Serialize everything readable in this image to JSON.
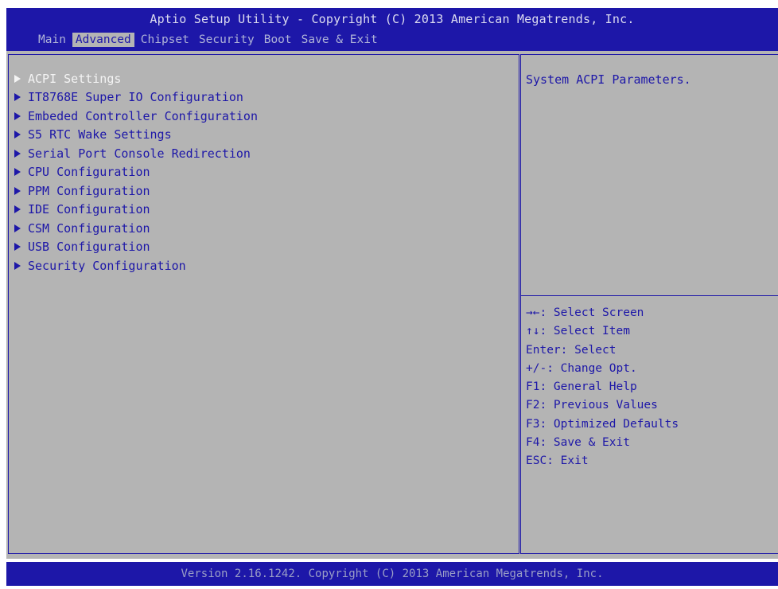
{
  "header": {
    "title": "Aptio Setup Utility - Copyright (C) 2013 American Megatrends, Inc.",
    "tabs": [
      {
        "label": "Main"
      },
      {
        "label": "Advanced"
      },
      {
        "label": "Chipset"
      },
      {
        "label": "Security"
      },
      {
        "label": "Boot"
      },
      {
        "label": "Save & Exit"
      }
    ],
    "active_tab": "Advanced"
  },
  "menu": {
    "selected_item": "ACPI Settings",
    "items": [
      {
        "label": "ACPI Settings"
      },
      {
        "label": "IT8768E Super IO Configuration"
      },
      {
        "label": "Embeded Controller Configuration"
      },
      {
        "label": "S5 RTC Wake Settings"
      },
      {
        "label": "Serial Port Console Redirection"
      },
      {
        "label": "CPU Configuration"
      },
      {
        "label": "PPM Configuration"
      },
      {
        "label": "IDE Configuration"
      },
      {
        "label": "CSM Configuration"
      },
      {
        "label": "USB Configuration"
      },
      {
        "label": "Security Configuration"
      }
    ]
  },
  "help": {
    "description": "System ACPI Parameters.",
    "keys": [
      "→←: Select Screen",
      "↑↓: Select Item",
      "Enter: Select",
      "+/-: Change Opt.",
      "F1: General Help",
      "F2: Previous Values",
      "F3: Optimized Defaults",
      "F4: Save & Exit",
      "ESC: Exit"
    ]
  },
  "footer": {
    "version": "Version 2.16.1242. Copyright (C) 2013 American Megatrends, Inc."
  },
  "colors": {
    "bios_blue": "#1d17a8",
    "bios_gray": "#b4b4b4",
    "selected_text": "#f4f4f4"
  }
}
